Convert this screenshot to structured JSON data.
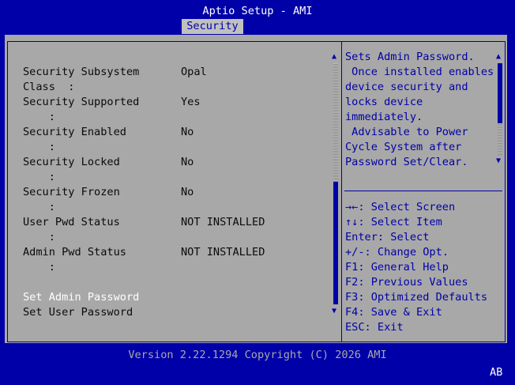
{
  "header": {
    "title": "Aptio Setup - AMI",
    "tab": "Security"
  },
  "info_rows": [
    {
      "label": "Security Subsystem\nClass  :",
      "value": "Opal"
    },
    {
      "label": "Security Supported\n    :",
      "value": "Yes"
    },
    {
      "label": "Security Enabled\n    :",
      "value": "No"
    },
    {
      "label": "Security Locked\n    :",
      "value": "No"
    },
    {
      "label": "Security Frozen\n    :",
      "value": "No"
    },
    {
      "label": "User Pwd Status\n    :",
      "value": "NOT INSTALLED"
    },
    {
      "label": "Admin Pwd Status\n    :",
      "value": "NOT INSTALLED"
    }
  ],
  "menu_items": [
    {
      "label": "Set Admin Password",
      "selected": true
    },
    {
      "label": "Set User Password",
      "selected": false
    }
  ],
  "help_text": [
    "Sets Admin Password.",
    " Once installed enables",
    "device security and",
    "locks device",
    "immediately.",
    " Advisable to Power",
    "Cycle System after",
    "Password Set/Clear."
  ],
  "key_help": [
    "→←: Select Screen",
    "↑↓: Select Item",
    "Enter: Select",
    "+/-: Change Opt.",
    "F1: General Help",
    "F2: Previous Values",
    "F3: Optimized Defaults",
    "F4: Save & Exit",
    "ESC: Exit"
  ],
  "footer": {
    "version": "Version 2.22.1294 Copyright (C) 2026 AMI",
    "mode": "AB"
  },
  "colors": {
    "background": "#0000a8",
    "panel": "#a8a8a8",
    "selected_text": "#ffffff",
    "help_text": "#0000a8"
  }
}
